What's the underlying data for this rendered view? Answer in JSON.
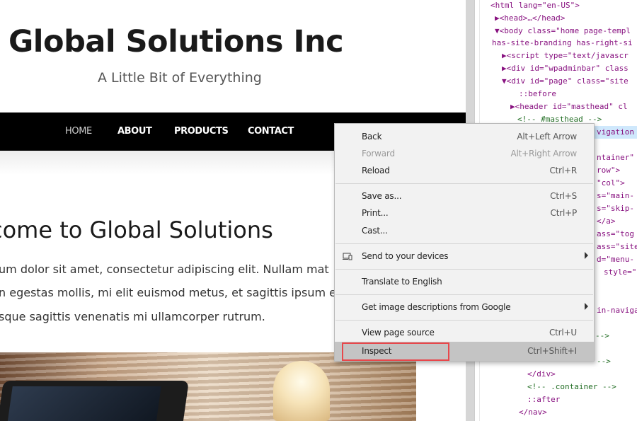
{
  "website": {
    "title": "Global Solutions Inc",
    "tagline": "A Little Bit of Everything",
    "nav": [
      {
        "label": "HOME",
        "current": true
      },
      {
        "label": "ABOUT",
        "current": false
      },
      {
        "label": "PRODUCTS",
        "current": false
      },
      {
        "label": "CONTACT",
        "current": false
      }
    ],
    "heading": "come to Global Solutions",
    "body_lines": [
      "um dolor sit amet, consectetur adipiscing elit. Nullam mat",
      "n egestas mollis, mi elit euismod metus, et sagittis ipsum e",
      "sque sagittis venenatis mi ullamcorper rutrum."
    ]
  },
  "devtools": {
    "lines": [
      "<html lang=\"en-US\">",
      "▶<head>…</head>",
      "▼<body class=\"home page-templ",
      "has-site-branding has-right-si",
      "▶<script type=\"text/javascr",
      "▶<div id=\"wpadminbar\" class",
      "▼<div id=\"page\" class=\"site",
      "::before",
      "▶<header id=\"masthead\" cl",
      "<!-- #masthead -->",
      "vigation",
      "ntainer\"",
      "row\">",
      "\"col\">",
      "s=\"main-",
      "s=\"skip-",
      "</a>",
      "ass=\"tog",
      "ass=\"site",
      "d=\"menu-",
      "style=\"",
      "in-naviga",
      "-->",
      "-->",
      "</div>",
      "<!-- .container -->",
      "::after",
      "</nav>"
    ]
  },
  "context_menu": {
    "items": [
      {
        "label": "Back",
        "shortcut": "Alt+Left Arrow",
        "disabled": false
      },
      {
        "label": "Forward",
        "shortcut": "Alt+Right Arrow",
        "disabled": true
      },
      {
        "label": "Reload",
        "shortcut": "Ctrl+R",
        "disabled": false
      },
      {
        "label": "Save as...",
        "shortcut": "Ctrl+S",
        "disabled": false
      },
      {
        "label": "Print...",
        "shortcut": "Ctrl+P",
        "disabled": false
      },
      {
        "label": "Cast...",
        "shortcut": "",
        "disabled": false
      },
      {
        "label": "Send to your devices",
        "submenu": true,
        "icon": "device-icon"
      },
      {
        "label": "Translate to English"
      },
      {
        "label": "Get image descriptions from Google",
        "submenu": true
      },
      {
        "label": "View page source",
        "shortcut": "Ctrl+U"
      },
      {
        "label": "Inspect",
        "shortcut": "Ctrl+Shift+I",
        "highlighted": true
      }
    ]
  },
  "colors": {
    "nav_bar": "#000000",
    "inspect_highlight_border": "#e8474b",
    "menu_background": "#f2f2f2",
    "devtools_selected_row": "#cfe8fc"
  }
}
